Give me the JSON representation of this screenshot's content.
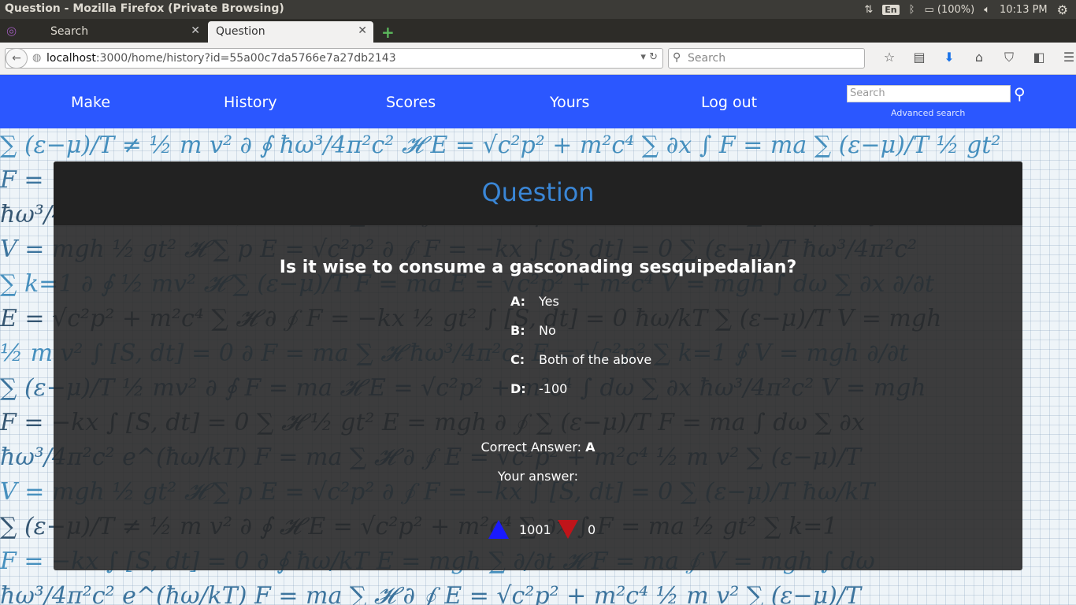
{
  "os": {
    "window_title": "Question - Mozilla Firefox (Private Browsing)",
    "keyboard": "En",
    "battery": "(100%)",
    "clock": "10:13 PM"
  },
  "browser": {
    "tabs": [
      {
        "label": "Search"
      },
      {
        "label": "Question"
      }
    ],
    "url_host": "localhost",
    "url_rest": ":3000/home/history?id=55a00c7da5766e7a27db2143",
    "search_placeholder": "Search"
  },
  "site": {
    "nav": [
      "Make",
      "History",
      "Scores",
      "Yours",
      "Log out"
    ],
    "search_placeholder": "Search",
    "advanced_search": "Advanced search"
  },
  "question_page": {
    "title": "Question",
    "question": "Is it wise to consume a gasconading sesquipedalian?",
    "options": [
      {
        "key": "A:",
        "text": "Yes"
      },
      {
        "key": "B:",
        "text": "No"
      },
      {
        "key": "C:",
        "text": "Both of the above"
      },
      {
        "key": "D:",
        "text": "-100"
      }
    ],
    "correct_label": "Correct Answer:",
    "correct_value": "A",
    "your_answer_label": "Your answer:",
    "upvotes": "1001",
    "downvotes": "0",
    "upvote_color": "#1a1aff",
    "downvote_color": "#c0141a"
  },
  "colors": {
    "nav_bg": "#2b57ff",
    "title_color": "#3a86d6"
  }
}
